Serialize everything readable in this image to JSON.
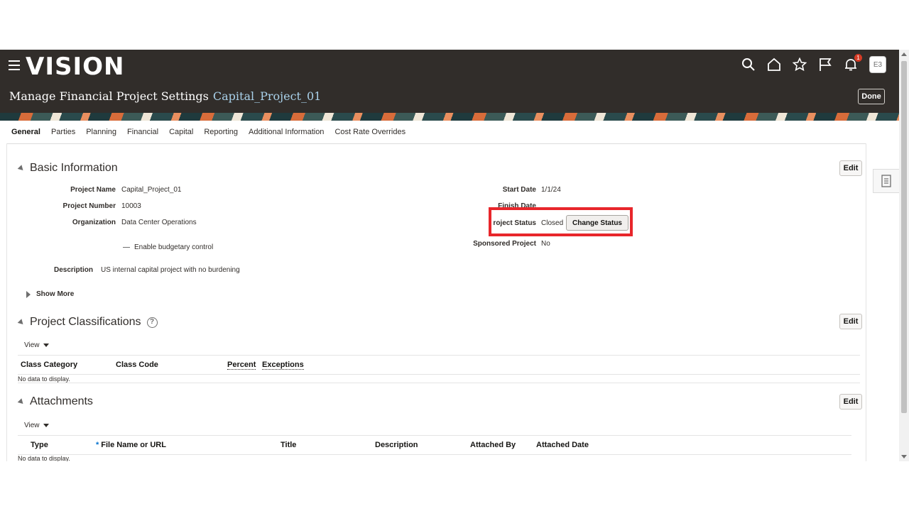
{
  "header": {
    "logo": "VISION",
    "page_title": "Manage Financial Project Settings",
    "project_name": "Capital_Project_01",
    "done_label": "Done",
    "notification_count": "1",
    "avatar_initials": "E3"
  },
  "tabs": [
    "General",
    "Parties",
    "Planning",
    "Financial",
    "Capital",
    "Reporting",
    "Additional Information",
    "Cost Rate Overrides"
  ],
  "active_tab": "General",
  "basic_info": {
    "title": "Basic Information",
    "edit_label": "Edit",
    "project_name_label": "Project Name",
    "project_name_value": "Capital_Project_01",
    "project_number_label": "Project Number",
    "project_number_value": "10003",
    "organization_label": "Organization",
    "organization_value": "Data Center Operations",
    "budgetary_label": "Enable budgetary control",
    "description_label": "Description",
    "description_value": "US internal capital project with no burdening",
    "start_date_label": "Start Date",
    "start_date_value": "1/1/24",
    "finish_date_label": "Finish Date",
    "project_status_label": "roject Status",
    "project_status_value": "Closed",
    "change_status_label": "Change Status",
    "sponsored_label": "Sponsored Project",
    "sponsored_value": "No",
    "show_more_label": "Show More"
  },
  "classifications": {
    "title": "Project Classifications",
    "edit_label": "Edit",
    "view_label": "View",
    "columns": [
      "Class Category",
      "Class Code",
      "Percent",
      "Exceptions"
    ],
    "empty_text": "No data to display."
  },
  "attachments": {
    "title": "Attachments",
    "edit_label": "Edit",
    "view_label": "View",
    "columns": [
      "Type",
      "File Name or URL",
      "Title",
      "Description",
      "Attached By",
      "Attached Date"
    ],
    "empty_text": "No data to display."
  },
  "colors": {
    "header_bg": "#312d2a",
    "link_blue": "#a9d1ea",
    "highlight_red": "#e8262b",
    "badge_red": "#d63b25"
  }
}
